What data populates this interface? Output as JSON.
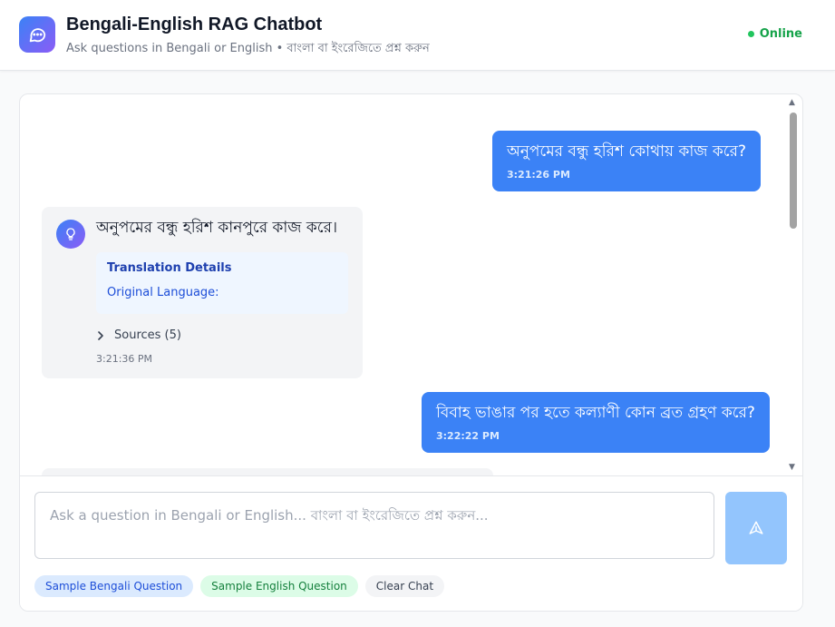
{
  "header": {
    "title": "Bengali-English RAG Chatbot",
    "subtitle": "Ask questions in Bengali or English • বাংলা বা ইংরেজিতে প্রশ্ন করুন",
    "status": "Online",
    "logo_icon": "chat-bubble-icon"
  },
  "colors": {
    "accent": "#3b82f6",
    "brand_gradient_start": "#3b82f6",
    "brand_gradient_end": "#8b5cf6",
    "online": "#22c55e"
  },
  "messages": [
    {
      "role": "user",
      "text": "অনুপমের বন্ধু হরিশ কোথায় কাজ করে?",
      "time": "3:21:26 PM"
    },
    {
      "role": "bot",
      "text": "অনুপমের বন্ধু হরিশ কানপুরে কাজ করে।",
      "avatar_icon": "lightbulb-icon",
      "translation": {
        "title": "Translation Details",
        "original_language_label": "Original Language:"
      },
      "sources_label": "Sources (5)",
      "time": "3:21:36 PM"
    },
    {
      "role": "user",
      "text": "বিবাহ ভাঙার পর হতে কল্যাণী কোন ব্রত গ্রহণ করে?",
      "time": "3:22:22 PM"
    }
  ],
  "input": {
    "placeholder": "Ask a question in Bengali or English... বাংলা বা ইংরেজিতে প্রশ্ন করুন...",
    "value": "",
    "send_icon": "send-icon"
  },
  "quick_actions": {
    "sample_bengali": "Sample Bengali Question",
    "sample_english": "Sample English Question",
    "clear_chat": "Clear Chat"
  }
}
